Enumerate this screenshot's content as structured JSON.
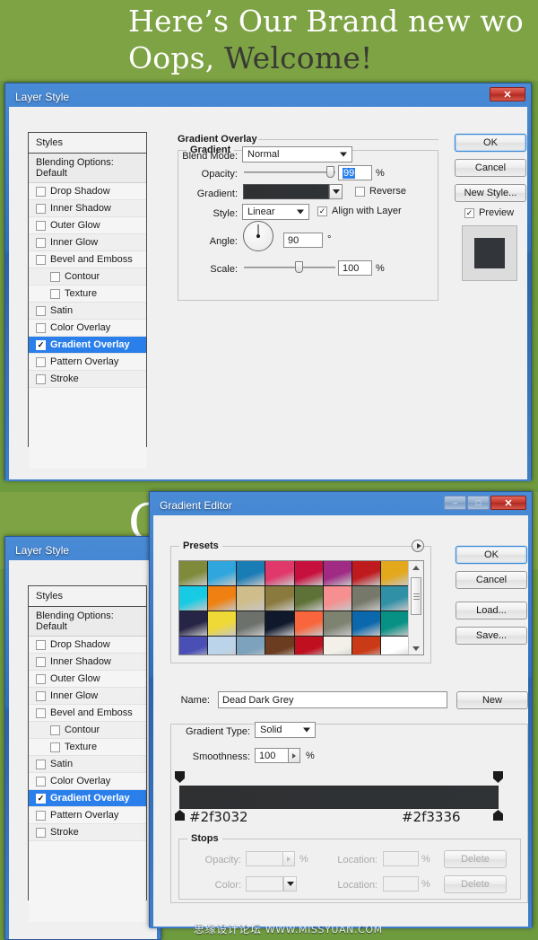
{
  "banner": {
    "line1_white": "Here’s Our Brand new wo",
    "line2_white": "Oops,",
    "line2_dark": " Welcome!",
    "bg_color": "#7da344",
    "second_band_letter": "O"
  },
  "layer_style_dialog": {
    "title": "Layer Style",
    "close_label": "✕",
    "styles_panel": {
      "header": "Styles",
      "blending_options": "Blending Options: Default",
      "items": [
        {
          "label": "Drop Shadow",
          "checked": false,
          "indent": false,
          "selected": false
        },
        {
          "label": "Inner Shadow",
          "checked": false,
          "indent": false,
          "selected": false
        },
        {
          "label": "Outer Glow",
          "checked": false,
          "indent": false,
          "selected": false
        },
        {
          "label": "Inner Glow",
          "checked": false,
          "indent": false,
          "selected": false
        },
        {
          "label": "Bevel and Emboss",
          "checked": false,
          "indent": false,
          "selected": false
        },
        {
          "label": "Contour",
          "checked": false,
          "indent": true,
          "selected": false
        },
        {
          "label": "Texture",
          "checked": false,
          "indent": true,
          "selected": false
        },
        {
          "label": "Satin",
          "checked": false,
          "indent": false,
          "selected": false
        },
        {
          "label": "Color Overlay",
          "checked": false,
          "indent": false,
          "selected": false
        },
        {
          "label": "Gradient Overlay",
          "checked": true,
          "indent": false,
          "selected": true
        },
        {
          "label": "Pattern Overlay",
          "checked": false,
          "indent": false,
          "selected": false
        },
        {
          "label": "Stroke",
          "checked": false,
          "indent": false,
          "selected": false
        }
      ]
    },
    "section_title": "Gradient Overlay",
    "group_caption": "Gradient",
    "fields": {
      "blend_mode_label": "Blend Mode:",
      "blend_mode_value": "Normal",
      "opacity_label": "Opacity:",
      "opacity_value": "99",
      "opacity_unit": "%",
      "gradient_label": "Gradient:",
      "gradient_start": "#2f3032",
      "gradient_end": "#2f3336",
      "reverse_label": "Reverse",
      "reverse_checked": false,
      "style_label": "Style:",
      "style_value": "Linear",
      "align_label": "Align with Layer",
      "align_checked": true,
      "angle_label": "Angle:",
      "angle_value": "90",
      "angle_unit": "°",
      "scale_label": "Scale:",
      "scale_value": "100",
      "scale_unit": "%"
    },
    "buttons": {
      "ok": "OK",
      "cancel": "Cancel",
      "new_style": "New Style...",
      "preview_label": "Preview",
      "preview_checked": true,
      "preview_chip_color": "#32363a"
    }
  },
  "gradient_editor": {
    "title": "Gradient Editor",
    "min_label": "–",
    "max_label": "□",
    "close_label": "✕",
    "presets_caption": "Presets",
    "presets_colors": [
      "#7f8b3a",
      "#2fa6dd",
      "#1a7cb5",
      "#e0386a",
      "#c8103f",
      "#a02a84",
      "#bf1b1e",
      "#e3a81c",
      "#17cbe4",
      "#ef8011",
      "#cfbd8b",
      "#8a7a3d",
      "#5e7136",
      "#f68f8f",
      "#76786a",
      "#2f90a6",
      "#272546",
      "#eed937",
      "#6d716c",
      "#10182b",
      "#f9653c",
      "#7d8271",
      "#0c68ad",
      "#069184",
      "#4a4fb5",
      "#bcd4ea",
      "#7da2bd",
      "#6b3c1f",
      "#c0101f",
      "#f2f0e8",
      "#cb3a17",
      "#ffffff"
    ],
    "name_label": "Name:",
    "name_value": "Dead Dark Grey",
    "new_button": "New",
    "gradient_type_label": "Gradient Type:",
    "gradient_type_value": "Solid",
    "smoothness_label": "Smoothness:",
    "smoothness_value": "100",
    "smoothness_unit": "%",
    "gradient_left_hex": "#2f3032",
    "gradient_right_hex": "#2f3336",
    "stops_caption": "Stops",
    "stops": {
      "opacity_label": "Opacity:",
      "opacity_value": "",
      "opacity_unit": "%",
      "opacity_location_label": "Location:",
      "opacity_location_value": "",
      "opacity_location_unit": "%",
      "opacity_delete": "Delete",
      "color_label": "Color:",
      "color_location_label": "Location:",
      "color_location_value": "",
      "color_location_unit": "%",
      "color_delete": "Delete"
    },
    "buttons": {
      "ok": "OK",
      "cancel": "Cancel",
      "load": "Load...",
      "save": "Save..."
    }
  },
  "watermark": {
    "chinese": "思缘设计论坛",
    "url": "WWW.MISSYUAN.COM"
  }
}
